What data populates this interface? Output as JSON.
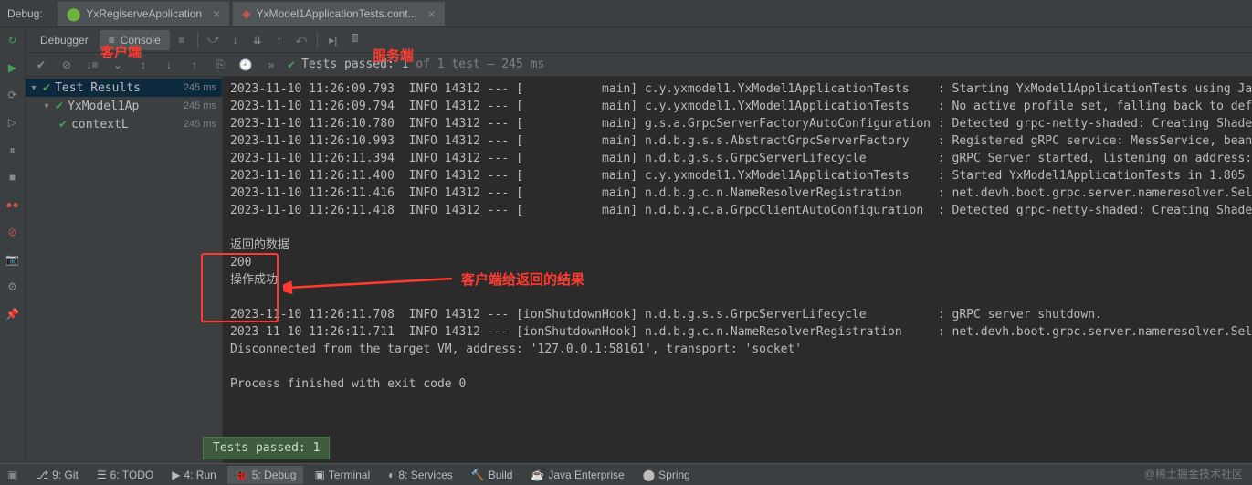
{
  "tabbar": {
    "label": "Debug:",
    "tabs": [
      {
        "label": "YxRegiserveApplication"
      },
      {
        "label": "YxModel1ApplicationTests.cont..."
      }
    ]
  },
  "subbar": {
    "debugger_label": "Debugger",
    "console_label": "Console"
  },
  "status": {
    "prefix": "Tests passed: 1",
    "suffix": " of 1 test – 245 ms"
  },
  "tree": {
    "root": {
      "name": "Test Results",
      "time": "245 ms"
    },
    "node1": {
      "name": "YxModel1Ap",
      "time": "245 ms"
    },
    "node2": {
      "name": "contextL",
      "time": "245 ms"
    }
  },
  "console_lines": [
    "2023-11-10 11:26:09.793  INFO 14312 --- [           main] c.y.yxmodel1.YxModel1ApplicationTests    : Starting YxModel1ApplicationTests using Ja",
    "2023-11-10 11:26:09.794  INFO 14312 --- [           main] c.y.yxmodel1.YxModel1ApplicationTests    : No active profile set, falling back to def",
    "2023-11-10 11:26:10.780  INFO 14312 --- [           main] g.s.a.GrpcServerFactoryAutoConfiguration : Detected grpc-netty-shaded: Creating Shade",
    "2023-11-10 11:26:10.993  INFO 14312 --- [           main] n.d.b.g.s.s.AbstractGrpcServerFactory    : Registered gRPC service: MessService, bean",
    "2023-11-10 11:26:11.394  INFO 14312 --- [           main] n.d.b.g.s.s.GrpcServerLifecycle          : gRPC Server started, listening on address:",
    "2023-11-10 11:26:11.400  INFO 14312 --- [           main] c.y.yxmodel1.YxModel1ApplicationTests    : Started YxModel1ApplicationTests in 1.805 ",
    "2023-11-10 11:26:11.416  INFO 14312 --- [           main] n.d.b.g.c.n.NameResolverRegistration     : net.devh.boot.grpc.server.nameresolver.Sel",
    "2023-11-10 11:26:11.418  INFO 14312 --- [           main] n.d.b.g.c.a.GrpcClientAutoConfiguration  : Detected grpc-netty-shaded: Creating Shade",
    "",
    "返回的数据",
    "200",
    "操作成功",
    "",
    "2023-11-10 11:26:11.708  INFO 14312 --- [ionShutdownHook] n.d.b.g.s.s.GrpcServerLifecycle          : gRPC server shutdown.",
    "2023-11-10 11:26:11.711  INFO 14312 --- [ionShutdownHook] n.d.b.g.c.n.NameResolverRegistration     : net.devh.boot.grpc.server.nameresolver.Sel",
    "Disconnected from the target VM, address: '127.0.0.1:58161', transport: 'socket'",
    "",
    "Process finished with exit code 0"
  ],
  "balloon": "Tests passed: 1",
  "annotations": {
    "client_label": "客户端",
    "server_label": "服务端",
    "result_label": "客户端给返回的结果"
  },
  "statusbar": {
    "git": "9: Git",
    "todo": "6: TODO",
    "run": "4: Run",
    "debug": "5: Debug",
    "terminal": "Terminal",
    "services": "8: Services",
    "build": "Build",
    "javaee": "Java Enterprise",
    "spring": "Spring"
  },
  "watermark": "@稀土掘金技术社区"
}
